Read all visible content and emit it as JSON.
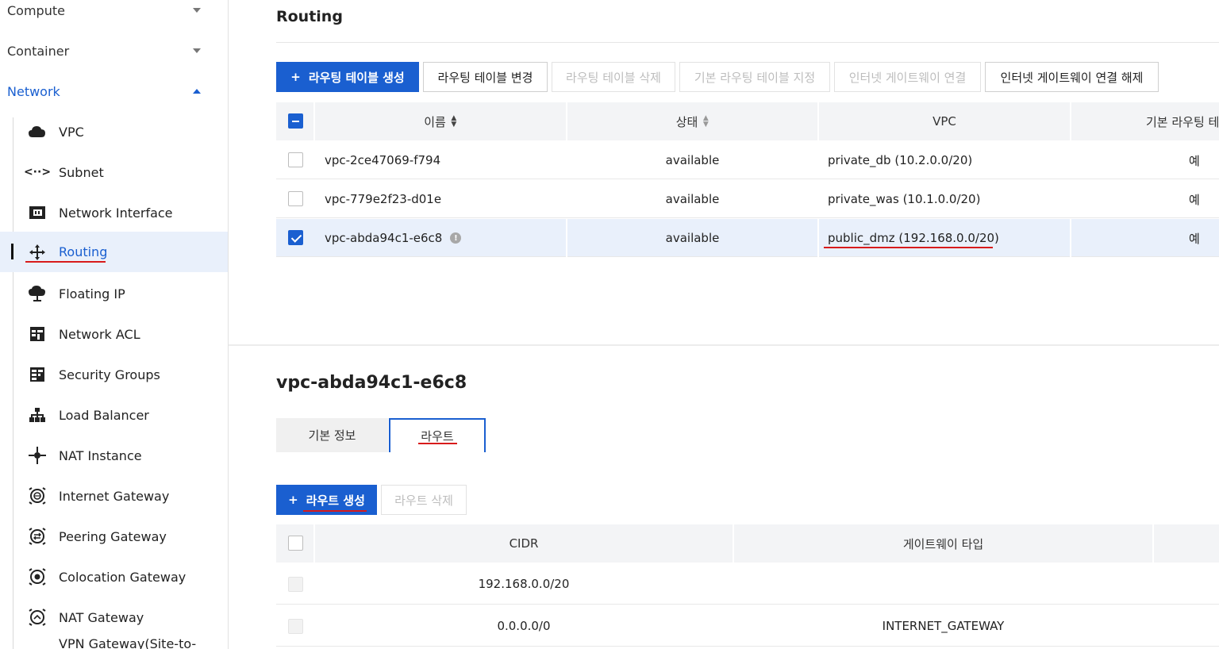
{
  "sidebar": {
    "categories": [
      {
        "label": "Compute",
        "expanded": false
      },
      {
        "label": "Container",
        "expanded": false
      },
      {
        "label": "Network",
        "expanded": true
      }
    ],
    "items": [
      {
        "label": "VPC",
        "icon": "cloud-icon"
      },
      {
        "label": "Subnet",
        "icon": "code-arrows-icon"
      },
      {
        "label": "Network Interface",
        "icon": "network-card-icon"
      },
      {
        "label": "Routing",
        "icon": "routing-arrows-icon",
        "selected": true
      },
      {
        "label": "Floating IP",
        "icon": "cloud-pin-icon"
      },
      {
        "label": "Network ACL",
        "icon": "acl-grid-icon"
      },
      {
        "label": "Security Groups",
        "icon": "security-grid-icon"
      },
      {
        "label": "Load Balancer",
        "icon": "hierarchy-icon"
      },
      {
        "label": "NAT Instance",
        "icon": "nat-node-icon"
      },
      {
        "label": "Internet Gateway",
        "icon": "globe-gateway-icon"
      },
      {
        "label": "Peering Gateway",
        "icon": "swap-gateway-icon"
      },
      {
        "label": "Colocation Gateway",
        "icon": "dot-gateway-icon"
      },
      {
        "label": "NAT Gateway",
        "icon": "nat-gateway-icon"
      },
      {
        "label": "VPN Gateway(Site-to-",
        "icon": "vpn-gateway-icon"
      }
    ]
  },
  "main": {
    "title": "Routing",
    "toolbar": {
      "create": "라우팅 테이블 생성",
      "modify": "라우팅 테이블 변경",
      "delete": "라우팅 테이블 삭제",
      "set_default": "기본 라우팅 테이블 지정",
      "connect_igw": "인터넷 게이트웨이 연결",
      "disconnect_igw": "인터넷 게이트웨이 연결 해제"
    },
    "table": {
      "headers": [
        "이름",
        "상태",
        "VPC",
        "기본 라우팅 테"
      ],
      "rows": [
        {
          "name": "vpc-2ce47069-f794",
          "status": "available",
          "vpc": "private_db (10.2.0.0/20)",
          "default": "예",
          "checked": false
        },
        {
          "name": "vpc-779e2f23-d01e",
          "status": "available",
          "vpc": "private_was (10.1.0.0/20)",
          "default": "예",
          "checked": false
        },
        {
          "name": "vpc-abda94c1-e6c8",
          "status": "available",
          "vpc": "public_dmz (192.168.0.0/20)",
          "default": "예",
          "checked": true
        }
      ]
    }
  },
  "detail": {
    "title": "vpc-abda94c1-e6c8",
    "tabs": [
      "기본 정보",
      "라우트"
    ],
    "active_tab": "라우트",
    "toolbar": {
      "create": "라우트 생성",
      "delete": "라우트 삭제"
    },
    "table": {
      "headers": [
        "CIDR",
        "게이트웨이 타입"
      ],
      "rows": [
        {
          "cidr": "192.168.0.0/20",
          "gateway_type": ""
        },
        {
          "cidr": "0.0.0.0/0",
          "gateway_type": "INTERNET_GATEWAY"
        }
      ]
    }
  },
  "colors": {
    "accent": "#1a5fd0",
    "highlight_underline": "#d81b1b",
    "selected_row": "#e9f0fb"
  }
}
